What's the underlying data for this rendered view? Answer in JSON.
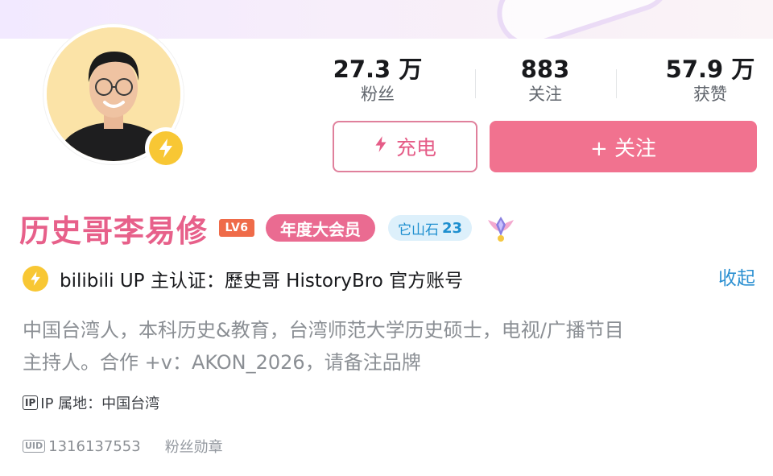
{
  "profile": {
    "username": "历史哥李易修",
    "level_badge": "LV6",
    "vip_badge": "年度大会员",
    "stone_badge": {
      "label": "它山石",
      "count": "23"
    },
    "certification": "bilibili UP 主认证：歷史哥 HistoryBro 官方账号",
    "collapse_label": "收起",
    "bio": [
      "中国台湾人，本科历史&教育，台湾师范大学历史硕士，电视/广播节目",
      "主持人。合作 +v：AKON_2026，请备注品牌"
    ],
    "ip_tag": "IP",
    "ip_location": "IP 属地：中国台湾",
    "uid_tag": "UID",
    "uid": "1316137553",
    "fan_medal_label": "粉丝勋章"
  },
  "stats": {
    "fans": {
      "value": "27.3 万",
      "label": "粉丝"
    },
    "following": {
      "value": "883",
      "label": "关注"
    },
    "likes": {
      "value": "57.9 万",
      "label": "获赞"
    }
  },
  "actions": {
    "charge_label": "充电",
    "follow_label": "+ 关注"
  },
  "icons": {
    "verify_badge": "lightning-icon",
    "charge": "lightning-icon",
    "medal": "winged-medal-icon"
  },
  "colors": {
    "accent_pink": "#f1728f",
    "username_pink": "#e7608a",
    "verify_yellow": "#f8c734",
    "link_blue": "#2a8fd1"
  }
}
